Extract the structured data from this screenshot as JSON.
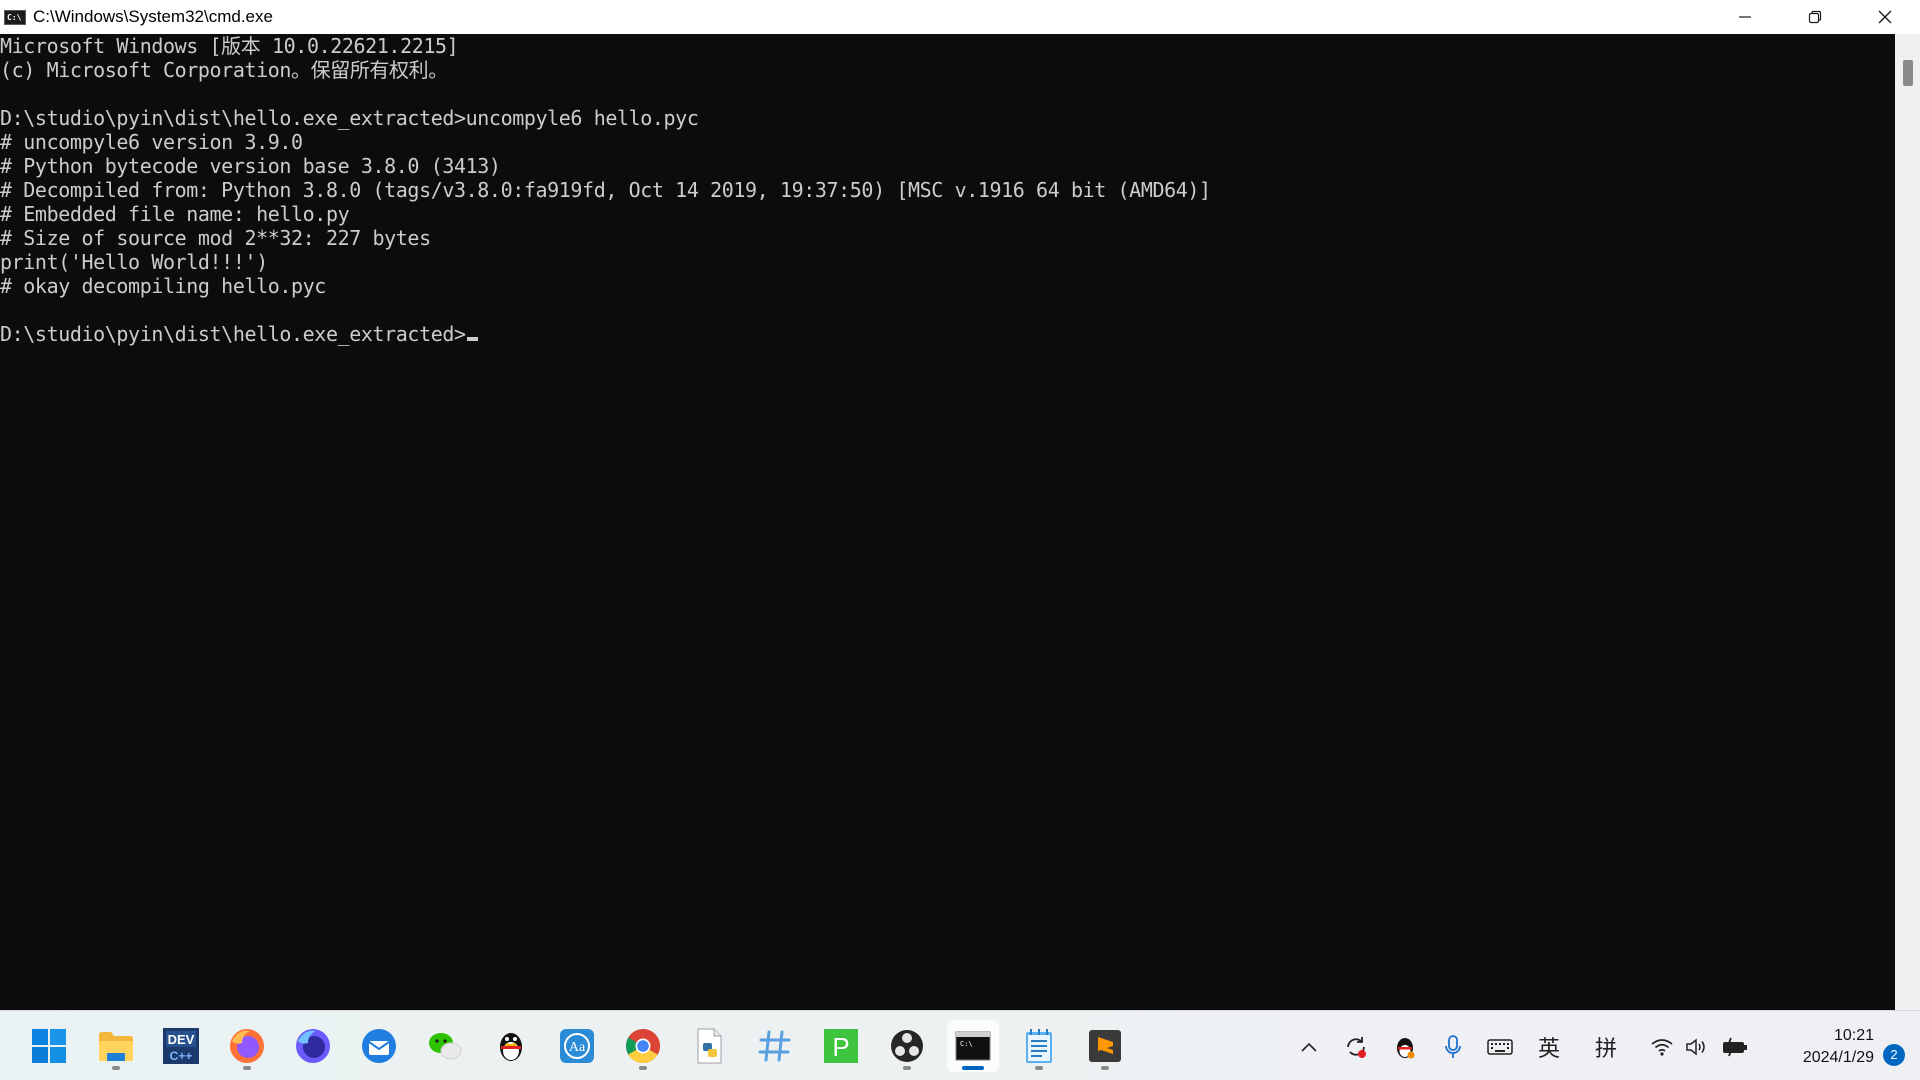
{
  "window": {
    "title": "C:\\Windows\\System32\\cmd.exe",
    "icon_text": "C:\\"
  },
  "console": {
    "lines": [
      "Microsoft Windows [版本 10.0.22621.2215]",
      "(c) Microsoft Corporation。保留所有权利。",
      "",
      "D:\\studio\\pyin\\dist\\hello.exe_extracted>uncompyle6 hello.pyc",
      "# uncompyle6 version 3.9.0",
      "# Python bytecode version base 3.8.0 (3413)",
      "# Decompiled from: Python 3.8.0 (tags/v3.8.0:fa919fd, Oct 14 2019, 19:37:50) [MSC v.1916 64 bit (AMD64)]",
      "# Embedded file name: hello.py",
      "# Size of source mod 2**32: 227 bytes",
      "print('Hello World!!!')",
      "# okay decompiling hello.pyc",
      "",
      "D:\\studio\\pyin\\dist\\hello.exe_extracted>"
    ]
  },
  "taskbar": {
    "apps": [
      {
        "name": "start-button",
        "icon": "windows-logo-icon",
        "running": false
      },
      {
        "name": "taskbar-file-explorer",
        "icon": "folder-icon",
        "running": true
      },
      {
        "name": "taskbar-devcpp",
        "icon": "devcpp-icon",
        "running": false,
        "label": "DEV"
      },
      {
        "name": "taskbar-firefox",
        "icon": "firefox-icon",
        "running": true
      },
      {
        "name": "taskbar-firefox-dev",
        "icon": "firefox-dev-icon",
        "running": false
      },
      {
        "name": "taskbar-thunderbird",
        "icon": "thunderbird-icon",
        "running": false
      },
      {
        "name": "taskbar-wechat",
        "icon": "wechat-icon",
        "running": false
      },
      {
        "name": "taskbar-qq",
        "icon": "qq-penguin-icon",
        "running": false
      },
      {
        "name": "taskbar-dictionary",
        "icon": "dictionary-icon",
        "running": false,
        "label": "Aa"
      },
      {
        "name": "taskbar-chrome",
        "icon": "chrome-icon",
        "running": true
      },
      {
        "name": "taskbar-python",
        "icon": "python-file-icon",
        "running": false
      },
      {
        "name": "taskbar-slack",
        "icon": "hash-icon",
        "running": false
      },
      {
        "name": "taskbar-pycharm",
        "icon": "p-icon",
        "running": false,
        "label": "P"
      },
      {
        "name": "taskbar-obs",
        "icon": "obs-icon",
        "running": true
      },
      {
        "name": "taskbar-cmd",
        "icon": "terminal-icon",
        "running": true,
        "active": true
      },
      {
        "name": "taskbar-notepad",
        "icon": "notepad-icon",
        "running": true
      },
      {
        "name": "taskbar-sublime",
        "icon": "sublime-icon",
        "running": true,
        "label": "S"
      }
    ],
    "tray": {
      "ime_lang": "英",
      "ime_mode": "拼",
      "time": "10:21",
      "date": "2024/1/29",
      "notifications": "2"
    }
  }
}
